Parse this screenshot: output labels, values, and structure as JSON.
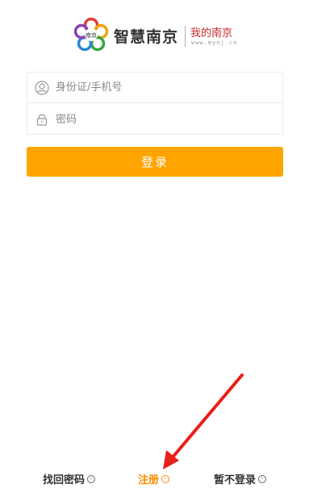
{
  "logo": {
    "title": "智慧南京",
    "subtitle": "我的南京",
    "url": "www.mynj.cn",
    "mark_text": "南京"
  },
  "form": {
    "username_placeholder": "身份证/手机号",
    "password_placeholder": "密码"
  },
  "login_label": "登录",
  "bottom": {
    "find_password": "找回密码",
    "register": "注册",
    "skip_login": "暂不登录"
  },
  "colors": {
    "accent": "#ffa400",
    "register": "#ff8a00",
    "logo_red": "#c8282d",
    "annotation_arrow": "#e8201a"
  }
}
